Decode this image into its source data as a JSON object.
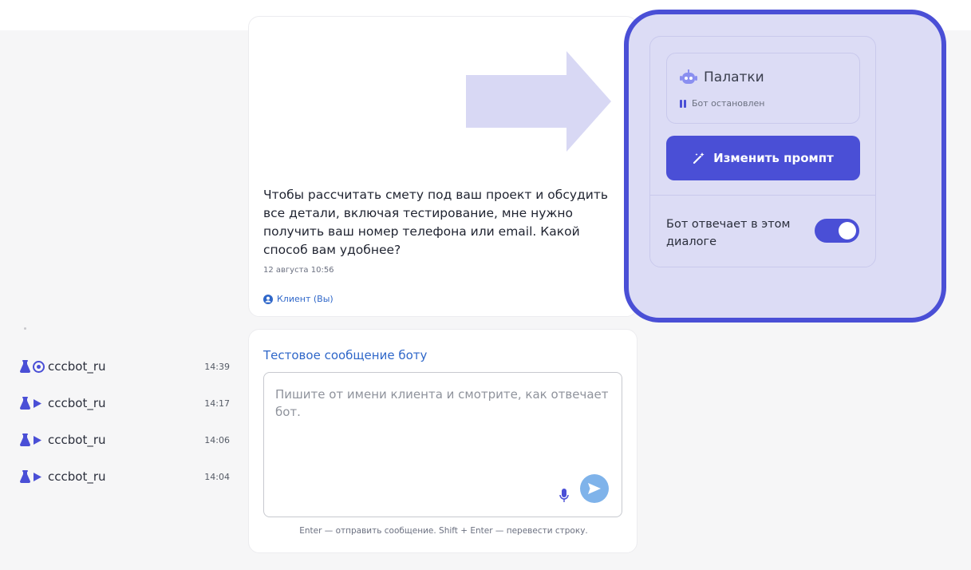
{
  "conversations": [
    {
      "name": "cccbot_ru",
      "time": "14:39",
      "status_icon": "target-icon"
    },
    {
      "name": "cccbot_ru",
      "time": "14:17",
      "status_icon": "play-icon"
    },
    {
      "name": "cccbot_ru",
      "time": "14:06",
      "status_icon": "play-icon"
    },
    {
      "name": "cccbot_ru",
      "time": "14:04",
      "status_icon": "play-icon"
    }
  ],
  "message": {
    "text": "Чтобы рассчитать смету под ваш проект и обсудить все детали, включая тестирование, мне нужно получить ваш номер телефона или email. Какой способ вам удобнее?",
    "date": "12 августа 10:56",
    "author": "Клиент (Вы)"
  },
  "test": {
    "title": "Тестовое сообщение боту",
    "placeholder": "Пишите от имени клиента и смотрите, как отвечает бот.",
    "hint": "Enter — отправить сообщение. Shift + Enter — перевести строку."
  },
  "bot_panel": {
    "name": "Палатки",
    "status": "Бот остановлен",
    "edit_button": "Изменить промпт",
    "toggle_label": "Бот отвечает в этом диалоге",
    "toggle_on": true
  },
  "colors": {
    "accent": "#4a4fd6",
    "link": "#2f67c9",
    "panel_bg": "#dcdcf5",
    "send": "#7fb3ea"
  }
}
